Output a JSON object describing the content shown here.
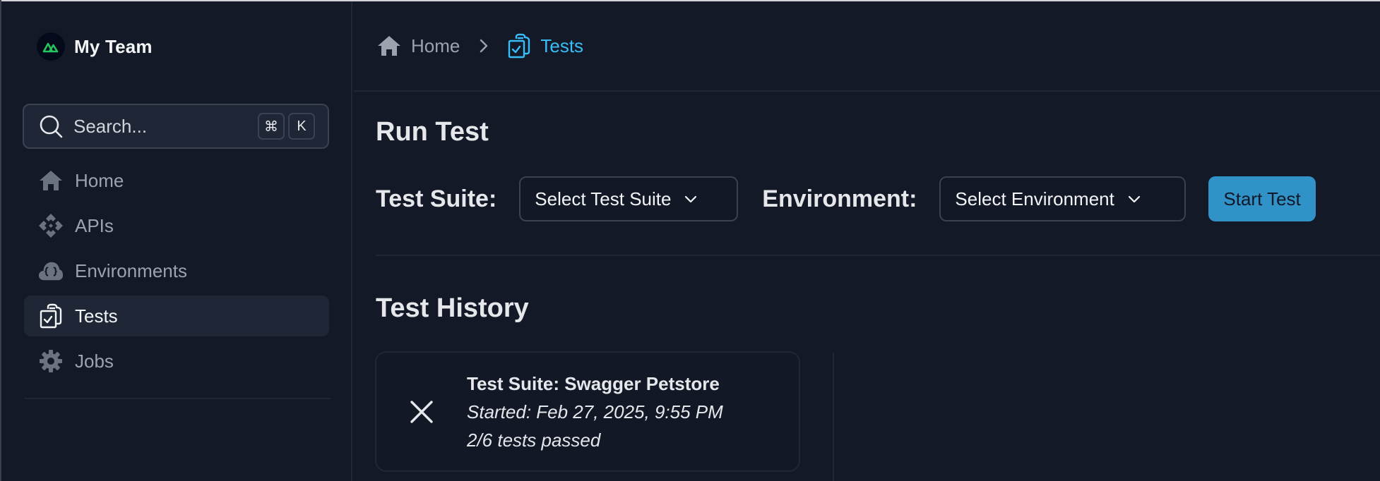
{
  "sidebar": {
    "team_name": "My Team",
    "team_logo_color": "#22c55e",
    "search": {
      "placeholder": "Search...",
      "shortcut_keys": [
        "⌘",
        "K"
      ]
    },
    "items": [
      {
        "label": "Home",
        "icon": "home-icon",
        "active": false
      },
      {
        "label": "APIs",
        "icon": "apis-icon",
        "active": false
      },
      {
        "label": "Environments",
        "icon": "cloud-code-icon",
        "active": false
      },
      {
        "label": "Tests",
        "icon": "clipboard-check-icon",
        "active": true
      },
      {
        "label": "Jobs",
        "icon": "gear-icon",
        "active": false
      }
    ]
  },
  "breadcrumb": {
    "items": [
      {
        "label": "Home",
        "icon": "home-icon"
      },
      {
        "label": "Tests",
        "icon": "clipboard-check-icon",
        "current": true
      }
    ],
    "separator_icon": "chevron-right-icon"
  },
  "run_test": {
    "title": "Run Test",
    "suite_label": "Test Suite:",
    "suite_select": {
      "value": "Select Test Suite"
    },
    "environment_label": "Environment:",
    "environment_select": {
      "value": "Select Environment"
    },
    "start_button": "Start Test",
    "accent_color": "#3192c7"
  },
  "test_history": {
    "title": "Test History",
    "entries": [
      {
        "status": "failed",
        "status_icon": "x-icon",
        "title": "Test Suite: Swagger Petstore",
        "started": "Started: Feb 27, 2025, 9:55 PM",
        "result": "2/6 tests passed"
      }
    ]
  }
}
